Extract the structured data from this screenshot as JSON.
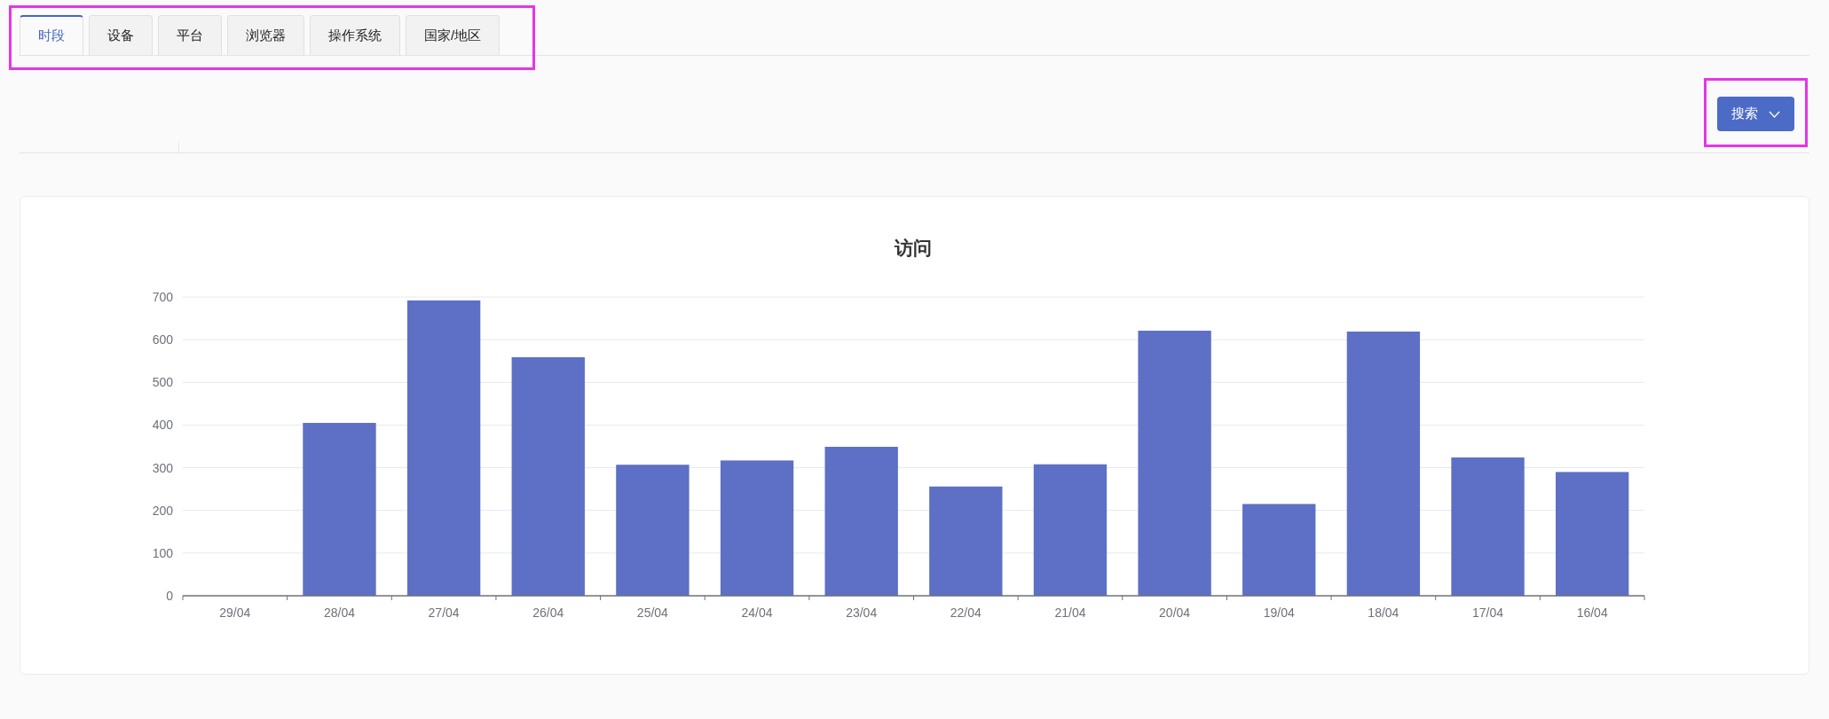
{
  "tabs": [
    {
      "label": "时段",
      "selected": true
    },
    {
      "label": "设备",
      "selected": false
    },
    {
      "label": "平台",
      "selected": false
    },
    {
      "label": "浏览器",
      "selected": false
    },
    {
      "label": "操作系统",
      "selected": false
    },
    {
      "label": "国家/地区",
      "selected": false
    }
  ],
  "search_button": {
    "label": "搜索"
  },
  "chart": {
    "chart_data": {
      "type": "bar",
      "title": "访问",
      "categories": [
        "29/04",
        "28/04",
        "27/04",
        "26/04",
        "25/04",
        "24/04",
        "23/04",
        "22/04",
        "21/04",
        "20/04",
        "19/04",
        "18/04",
        "17/04",
        "16/04"
      ],
      "grid": true,
      "series": [
        {
          "color": "#5d70c5",
          "values": [
            0,
            405,
            692,
            559,
            307,
            317,
            349,
            256,
            308,
            621,
            215,
            619,
            324,
            290
          ]
        }
      ],
      "ylim": [
        0,
        700
      ],
      "yticks": [
        0,
        100,
        200,
        300,
        400,
        500,
        600,
        700
      ]
    }
  }
}
